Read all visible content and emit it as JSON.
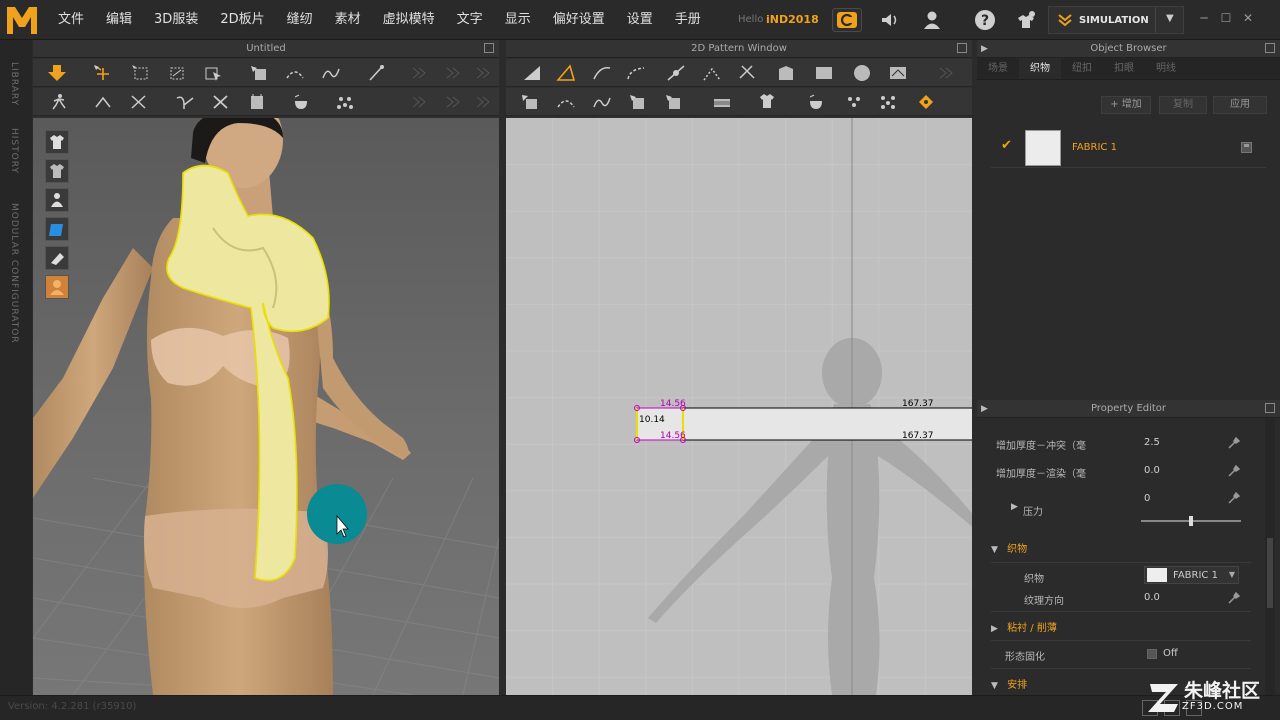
{
  "app": {
    "version": "Version: 4.2.281 (r35910)"
  },
  "menubar": {
    "menus": [
      "文件",
      "编辑",
      "3D服装",
      "2D板片",
      "缝纫",
      "素材",
      "虚拟模特",
      "文字",
      "显示",
      "偏好设置",
      "设置",
      "手册"
    ],
    "hello": "Hello",
    "username": "iND2018",
    "simulation_label": "SIMULATION"
  },
  "sidestrip": {
    "tabs": [
      "LIBRARY",
      "HISTORY",
      "MODULAR CONFIGURATOR"
    ]
  },
  "pane3d": {
    "title": "Untitled"
  },
  "pane2d": {
    "title": "2D Pattern Window",
    "measurements": {
      "top_left": "14.56",
      "bottom_left": "14.56",
      "height": "10.14",
      "top_right": "167.37",
      "bottom_right": "167.37"
    }
  },
  "object_browser": {
    "title": "Object Browser",
    "tabs": [
      "场景",
      "织物",
      "纽扣",
      "扣眼",
      "明线"
    ],
    "active_tab": "织物",
    "actions": {
      "add": "+ 增加",
      "copy": "复制",
      "apply": "应用"
    },
    "fabrics": [
      {
        "name": "FABRIC 1"
      }
    ]
  },
  "property_editor": {
    "title": "Property Editor",
    "rows": [
      {
        "label": "增加厚度－冲突（毫",
        "value": "2.5"
      },
      {
        "label": "增加厚度－渲染（毫",
        "value": "0.0"
      }
    ],
    "pressure": {
      "label": "压力",
      "value": "0",
      "slider_fraction": 0.5
    },
    "sections": {
      "fabric": "织物",
      "adhesive": "粘衬 / 削薄",
      "arrangement": "安排"
    },
    "fabric_field": {
      "label": "织物",
      "value": "FABRIC 1"
    },
    "grain": {
      "label": "纹理方向",
      "value": "0.0"
    },
    "shape_solid": {
      "label": "形态固化",
      "value": "Off"
    }
  },
  "watermark": {
    "cn": "朱峰社区",
    "url": "ZF3D.COM"
  },
  "colors": {
    "accent": "#f0a21c",
    "scarf": "#ede7a0",
    "selection": "#e8e000",
    "cursor_circle": "#0a8a92"
  }
}
